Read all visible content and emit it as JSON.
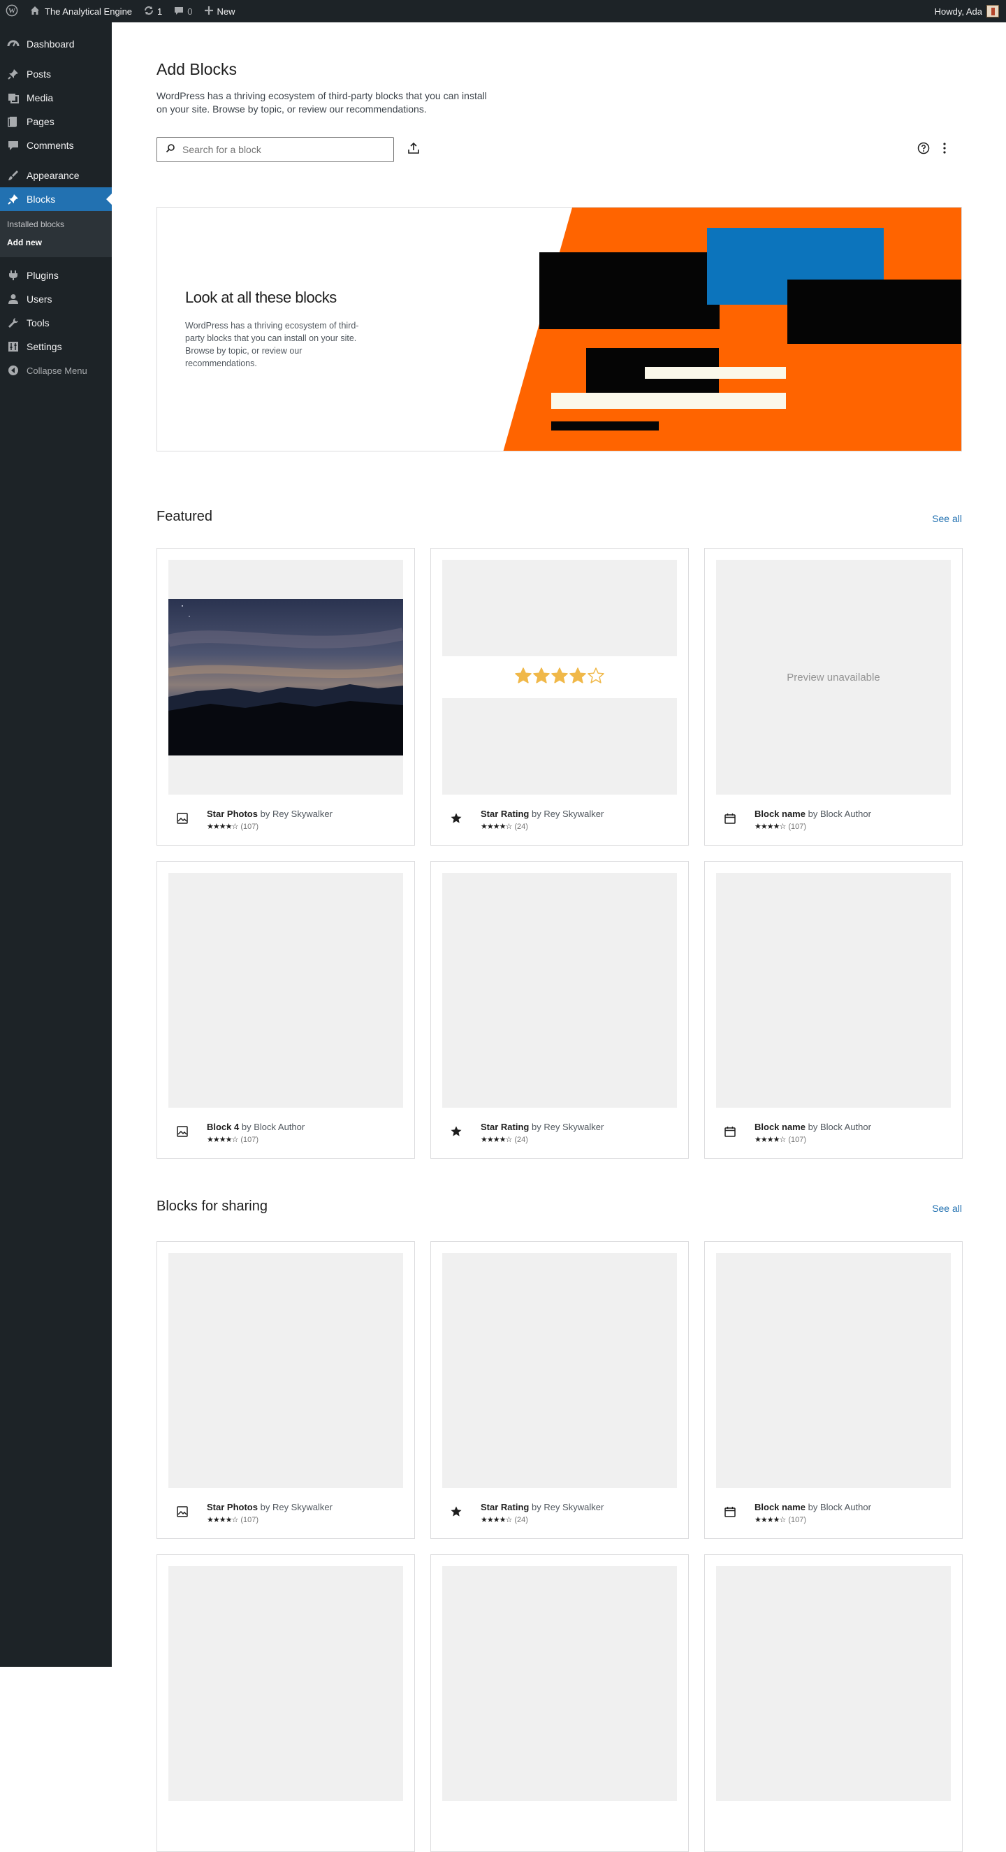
{
  "adminbar": {
    "site_name": "The Analytical Engine",
    "updates_count": "1",
    "comments_count": "0",
    "new_label": "New",
    "greeting": "Howdy, Ada"
  },
  "sidebar": {
    "items": [
      {
        "label": "Dashboard",
        "icon": "dashboard-icon"
      },
      {
        "label": "Posts",
        "icon": "pin-icon"
      },
      {
        "label": "Media",
        "icon": "media-icon"
      },
      {
        "label": "Pages",
        "icon": "pages-icon"
      },
      {
        "label": "Comments",
        "icon": "comment-icon"
      },
      {
        "label": "Appearance",
        "icon": "brush-icon"
      },
      {
        "label": "Blocks",
        "icon": "pin-icon"
      },
      {
        "label": "Plugins",
        "icon": "plug-icon"
      },
      {
        "label": "Users",
        "icon": "user-icon"
      },
      {
        "label": "Tools",
        "icon": "wrench-icon"
      },
      {
        "label": "Settings",
        "icon": "settings-icon"
      }
    ],
    "submenu": [
      "Installed blocks",
      "Add new"
    ],
    "collapse_label": "Collapse Menu"
  },
  "header": {
    "title": "Add Blocks",
    "description": "WordPress has a thriving ecosystem of third-party blocks that you can install on your site. Browse by topic, or review our recommendations.",
    "search_placeholder": "Search for a block"
  },
  "hero": {
    "title": "Look at all these blocks",
    "description": "WordPress has a thriving ecosystem of third-party blocks that you can install on your site. Browse by topic, or review our recommendations.",
    "colors": {
      "orange": "#ff6400",
      "blue": "#0c74bc",
      "black": "#050505",
      "cream": "#fbf8ea"
    }
  },
  "featured": {
    "title": "Featured",
    "see_all": "See all",
    "cards": [
      {
        "name": "Star Photos",
        "author": "Rey Skywalker",
        "stars": "★★★★☆",
        "count": "(107)",
        "icon": "image-icon",
        "preview": "photo"
      },
      {
        "name": "Star Rating",
        "author": "Rey Skywalker",
        "stars": "★★★★☆",
        "count": "(24)",
        "icon": "star-icon",
        "preview": "rating",
        "rating_value": 4
      },
      {
        "name": "Block name",
        "author": "Block Author",
        "stars": "★★★★☆",
        "count": "(107)",
        "icon": "calendar-icon",
        "preview": "unavailable",
        "preview_text": "Preview unavailable"
      },
      {
        "name": "Block 4",
        "author": "Block Author",
        "stars": "★★★★☆",
        "count": "(107)",
        "icon": "image-icon",
        "preview": "empty"
      },
      {
        "name": "Star Rating",
        "author": "Rey Skywalker",
        "stars": "★★★★☆",
        "count": "(24)",
        "icon": "star-icon",
        "preview": "empty"
      },
      {
        "name": "Block name",
        "author": "Block Author",
        "stars": "★★★★☆",
        "count": "(107)",
        "icon": "calendar-icon",
        "preview": "empty"
      }
    ]
  },
  "sharing": {
    "title": "Blocks for sharing",
    "see_all": "See all",
    "cards": [
      {
        "name": "Star Photos",
        "author": "Rey Skywalker",
        "stars": "★★★★☆",
        "count": "(107)",
        "icon": "image-icon",
        "preview": "empty"
      },
      {
        "name": "Star Rating",
        "author": "Rey Skywalker",
        "stars": "★★★★☆",
        "count": "(24)",
        "icon": "star-icon",
        "preview": "empty"
      },
      {
        "name": "Block name",
        "author": "Block Author",
        "stars": "★★★★☆",
        "count": "(107)",
        "icon": "calendar-icon",
        "preview": "empty"
      }
    ]
  },
  "by_word": "by"
}
